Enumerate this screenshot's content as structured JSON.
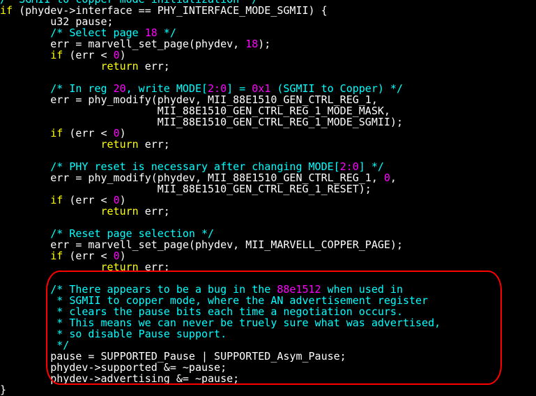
{
  "code_lines": [
    [
      {
        "t": "/* SGMII to copper mode initialization */",
        "c": "cm"
      }
    ],
    [
      {
        "t": "if",
        "c": "kw"
      },
      {
        "t": " (phydev->interface == PHY_INTERFACE_MODE_SGMII) {",
        "c": "txt"
      }
    ],
    [
      {
        "t": "        u32 pause;",
        "c": "txt"
      }
    ],
    [
      {
        "t": "        /* Select page ",
        "c": "cm"
      },
      {
        "t": "18",
        "c": "num"
      },
      {
        "t": " */",
        "c": "cm"
      }
    ],
    [
      {
        "t": "        err = marvell_set_page(phydev, ",
        "c": "txt"
      },
      {
        "t": "18",
        "c": "num"
      },
      {
        "t": ");",
        "c": "txt"
      }
    ],
    [
      {
        "t": "        ",
        "c": "txt"
      },
      {
        "t": "if",
        "c": "kw"
      },
      {
        "t": " (err < ",
        "c": "txt"
      },
      {
        "t": "0",
        "c": "num"
      },
      {
        "t": ")",
        "c": "txt"
      }
    ],
    [
      {
        "t": "                ",
        "c": "txt"
      },
      {
        "t": "return",
        "c": "kw"
      },
      {
        "t": " err;",
        "c": "txt"
      }
    ],
    [
      {
        "t": "",
        "c": "txt"
      }
    ],
    [
      {
        "t": "        /* In reg ",
        "c": "cm"
      },
      {
        "t": "20",
        "c": "num"
      },
      {
        "t": ", write MODE[",
        "c": "cm"
      },
      {
        "t": "2:0",
        "c": "num"
      },
      {
        "t": "] = ",
        "c": "cm"
      },
      {
        "t": "0x1",
        "c": "num"
      },
      {
        "t": " (SGMII to Copper) */",
        "c": "cm"
      }
    ],
    [
      {
        "t": "        err = phy_modify(phydev, MII_88E1510_GEN_CTRL_REG_1,",
        "c": "txt"
      }
    ],
    [
      {
        "t": "                         MII_88E1510_GEN_CTRL_REG_1_MODE_MASK,",
        "c": "txt"
      }
    ],
    [
      {
        "t": "                         MII_88E1510_GEN_CTRL_REG_1_MODE_SGMII);",
        "c": "txt"
      }
    ],
    [
      {
        "t": "        ",
        "c": "txt"
      },
      {
        "t": "if",
        "c": "kw"
      },
      {
        "t": " (err < ",
        "c": "txt"
      },
      {
        "t": "0",
        "c": "num"
      },
      {
        "t": ")",
        "c": "txt"
      }
    ],
    [
      {
        "t": "                ",
        "c": "txt"
      },
      {
        "t": "return",
        "c": "kw"
      },
      {
        "t": " err;",
        "c": "txt"
      }
    ],
    [
      {
        "t": "",
        "c": "txt"
      }
    ],
    [
      {
        "t": "        /* PHY reset is necessary after changing MODE[",
        "c": "cm"
      },
      {
        "t": "2:0",
        "c": "num"
      },
      {
        "t": "] */",
        "c": "cm"
      }
    ],
    [
      {
        "t": "        err = phy_modify(phydev, MII_88E1510_GEN_CTRL_REG_1, ",
        "c": "txt"
      },
      {
        "t": "0",
        "c": "num"
      },
      {
        "t": ",",
        "c": "txt"
      }
    ],
    [
      {
        "t": "                         MII_88E1510_GEN_CTRL_REG_1_RESET);",
        "c": "txt"
      }
    ],
    [
      {
        "t": "        ",
        "c": "txt"
      },
      {
        "t": "if",
        "c": "kw"
      },
      {
        "t": " (err < ",
        "c": "txt"
      },
      {
        "t": "0",
        "c": "num"
      },
      {
        "t": ")",
        "c": "txt"
      }
    ],
    [
      {
        "t": "                ",
        "c": "txt"
      },
      {
        "t": "return",
        "c": "kw"
      },
      {
        "t": " err;",
        "c": "txt"
      }
    ],
    [
      {
        "t": "",
        "c": "txt"
      }
    ],
    [
      {
        "t": "        /* Reset page selection */",
        "c": "cm"
      }
    ],
    [
      {
        "t": "        err = marvell_set_page(phydev, MII_MARVELL_COPPER_PAGE);",
        "c": "txt"
      }
    ],
    [
      {
        "t": "        ",
        "c": "txt"
      },
      {
        "t": "if",
        "c": "kw"
      },
      {
        "t": " (err < ",
        "c": "txt"
      },
      {
        "t": "0",
        "c": "num"
      },
      {
        "t": ")",
        "c": "txt"
      }
    ],
    [
      {
        "t": "                ",
        "c": "txt"
      },
      {
        "t": "return",
        "c": "kw"
      },
      {
        "t": " err;",
        "c": "txt"
      }
    ],
    [
      {
        "t": "",
        "c": "txt"
      }
    ],
    [
      {
        "t": "        /* There appears to be a bug in the ",
        "c": "cm"
      },
      {
        "t": "88e1512",
        "c": "num"
      },
      {
        "t": " when used in",
        "c": "cm"
      }
    ],
    [
      {
        "t": "         * SGMII to copper mode, where the AN advertisement register",
        "c": "cm"
      }
    ],
    [
      {
        "t": "         * clears the pause bits each time a negotiation occurs.",
        "c": "cm"
      }
    ],
    [
      {
        "t": "         * This means we can never be truely sure what was advertised,",
        "c": "cm"
      }
    ],
    [
      {
        "t": "         * so disable Pause support.",
        "c": "cm"
      }
    ],
    [
      {
        "t": "         */",
        "c": "cm"
      }
    ],
    [
      {
        "t": "        pause = SUPPORTED_Pause | SUPPORTED_Asym_Pause;",
        "c": "txt"
      }
    ],
    [
      {
        "t": "        phydev->supported &= ~pause;",
        "c": "txt"
      }
    ],
    [
      {
        "t": "        phydev->advertising &= ~pause;",
        "c": "txt"
      }
    ],
    [
      {
        "t": "}",
        "c": "txt"
      }
    ]
  ],
  "colors": {
    "background": "#000000",
    "keyword": "#ffff00",
    "comment": "#00ffff",
    "number": "#ff00ff",
    "text": "#ffffff",
    "annotation": "#ff0000"
  }
}
